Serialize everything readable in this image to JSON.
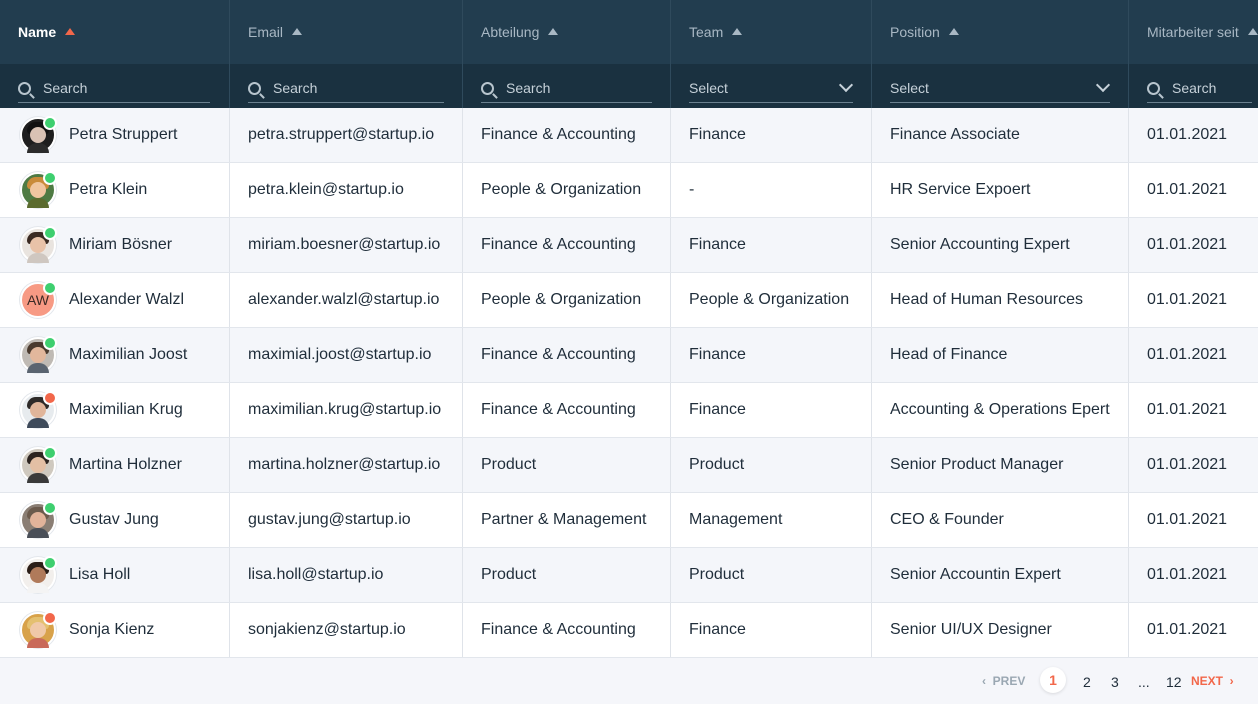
{
  "columns": [
    {
      "label": "Name",
      "active": true,
      "filter": {
        "type": "search",
        "placeholder": "Search"
      }
    },
    {
      "label": "Email",
      "filter": {
        "type": "search",
        "placeholder": "Search"
      }
    },
    {
      "label": "Abteilung",
      "filter": {
        "type": "search",
        "placeholder": "Search"
      }
    },
    {
      "label": "Team",
      "filter": {
        "type": "select",
        "placeholder": "Select"
      }
    },
    {
      "label": "Position",
      "filter": {
        "type": "select",
        "placeholder": "Select"
      }
    },
    {
      "label": "Mitarbeiter seit",
      "filter": {
        "type": "search",
        "placeholder": "Search"
      }
    }
  ],
  "rows": [
    {
      "name": "Petra Struppert",
      "email": "petra.struppert@startup.io",
      "dept": "Finance & Accounting",
      "team": "Finance",
      "position": "Finance Associate",
      "since": "01.01.2021",
      "status": "online",
      "avatar": {
        "type": "photo",
        "bg": "#1e1e1e",
        "skin": "#d9c2b4",
        "hair": "#111111",
        "shirt": "#2b2b2b"
      }
    },
    {
      "name": "Petra Klein",
      "email": "petra.klein@startup.io",
      "dept": "People & Organization",
      "team": "-",
      "position": "HR Service Expoert",
      "since": "01.01.2021",
      "status": "online",
      "avatar": {
        "type": "photo",
        "bg": "#4e7a43",
        "skin": "#f0c6a0",
        "hair": "#c98b3b",
        "shirt": "#5b6b2e"
      }
    },
    {
      "name": "Miriam Bösner",
      "email": "miriam.boesner@startup.io",
      "dept": "Finance & Accounting",
      "team": "Finance",
      "position": "Senior Accounting Expert",
      "since": "01.01.2021",
      "status": "online",
      "avatar": {
        "type": "photo",
        "bg": "#e9e4df",
        "skin": "#e8c2a8",
        "hair": "#3a2a22",
        "shirt": "#cfc7c0"
      }
    },
    {
      "name": "Alexander Walzl",
      "email": "alexander.walzl@startup.io",
      "dept": "People & Organization",
      "team": "People & Organization",
      "position": "Head of Human Resources",
      "since": "01.01.2021",
      "status": "online",
      "avatar": {
        "type": "initials",
        "initials": "AW"
      }
    },
    {
      "name": "Maximilian Joost",
      "email": "maximial.joost@startup.io",
      "dept": "Finance & Accounting",
      "team": "Finance",
      "position": "Head of Finance",
      "since": "01.01.2021",
      "status": "online",
      "avatar": {
        "type": "photo",
        "bg": "#bfbab4",
        "skin": "#e2b79c",
        "hair": "#4a3a2e",
        "shirt": "#5a6470"
      }
    },
    {
      "name": "Maximilian Krug",
      "email": "maximilian.krug@startup.io",
      "dept": "Finance & Accounting",
      "team": "Finance",
      "position": "Accounting & Operations Epert",
      "since": "01.01.2021",
      "status": "away",
      "avatar": {
        "type": "photo",
        "bg": "#e7ebee",
        "skin": "#e0b59a",
        "hair": "#2e2a28",
        "shirt": "#3e4a5a"
      }
    },
    {
      "name": "Martina Holzner",
      "email": "martina.holzner@startup.io",
      "dept": "Product",
      "team": "Product",
      "position": "Senior Product Manager",
      "since": "01.01.2021",
      "status": "online",
      "avatar": {
        "type": "photo",
        "bg": "#cfc9bf",
        "skin": "#e3bfa4",
        "hair": "#2c2420",
        "shirt": "#3a3a3a"
      }
    },
    {
      "name": "Gustav Jung",
      "email": "gustav.jung@startup.io",
      "dept": "Partner & Management",
      "team": "Management",
      "position": "CEO & Founder",
      "since": "01.01.2021",
      "status": "online",
      "avatar": {
        "type": "photo",
        "bg": "#8a7e74",
        "skin": "#e2b39a",
        "hair": "#6b5a4c",
        "shirt": "#4a4f58"
      }
    },
    {
      "name": "Lisa Holl",
      "email": "lisa.holl@startup.io",
      "dept": "Product",
      "team": "Product",
      "position": "Senior Accountin Expert",
      "since": "01.01.2021",
      "status": "online",
      "avatar": {
        "type": "photo",
        "bg": "#f2efec",
        "skin": "#b07a5a",
        "hair": "#2a1d16",
        "shirt": "#f4f4f4"
      }
    },
    {
      "name": "Sonja Kienz",
      "email": "sonjakienz@startup.io",
      "dept": "Finance & Accounting",
      "team": "Finance",
      "position": "Senior UI/UX Designer",
      "since": "01.01.2021",
      "status": "away",
      "avatar": {
        "type": "photo",
        "bg": "#d8a24a",
        "skin": "#f0c9a8",
        "hair": "#e4c070",
        "shirt": "#c96a5a"
      }
    }
  ],
  "pagination": {
    "prev": "PREV",
    "pages": [
      "1",
      "2",
      "3",
      "...",
      "12"
    ],
    "current": "1",
    "next": "NEXT"
  },
  "colors": {
    "header": "#223d4f",
    "filter_bar": "#1a3140",
    "accent": "#f2674a",
    "online": "#3ecf6f",
    "away": "#f2674a"
  }
}
